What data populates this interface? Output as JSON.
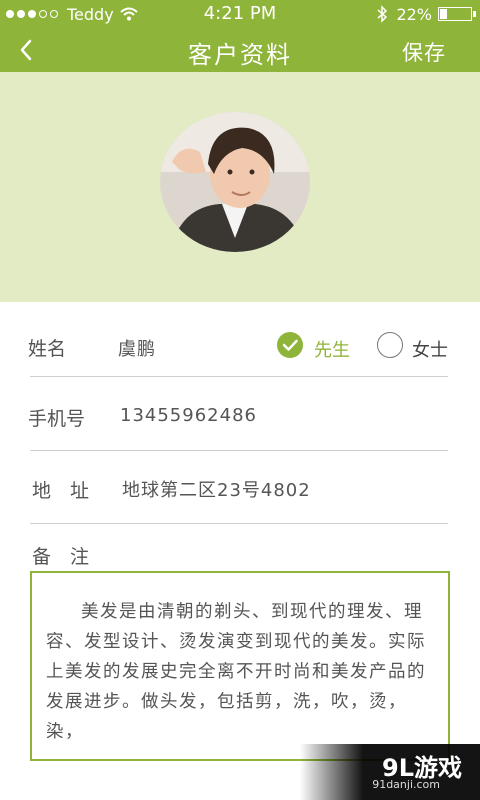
{
  "status_bar": {
    "carrier": "Teddy",
    "time": "4:21 PM",
    "battery": "22%",
    "battery_level": 0.22,
    "icons": [
      "signal-dots-icon",
      "wifi-icon",
      "bluetooth-icon",
      "battery-icon"
    ]
  },
  "nav": {
    "back_icon": "chevron-left-icon",
    "title": "客户资料",
    "save_label": "保存"
  },
  "profile": {
    "avatar": "customer-avatar-photo"
  },
  "form": {
    "name_label": "姓名",
    "name_value": "虞鹏",
    "gender_options": [
      {
        "label": "先生",
        "selected": true
      },
      {
        "label": "女士",
        "selected": false
      }
    ],
    "phone_label": "手机号",
    "phone_value": "13455962486",
    "address_label": "地　址",
    "address_value": "地球第二区23号4802",
    "note_label": "备　注",
    "note_text": "美发是由清朝的剃头、到现代的理发、理容、发型设计、烫发演变到现代的美发。实际上美发的发展史完全离不开时尚和美发产品的发展进步。做头发，包括剪，洗，吹，烫，染，"
  },
  "watermark": {
    "main": "9L游戏",
    "sub": "91danji.com"
  },
  "colors": {
    "accent": "#8fb43a",
    "hero_bg": "#e2ebc3"
  }
}
